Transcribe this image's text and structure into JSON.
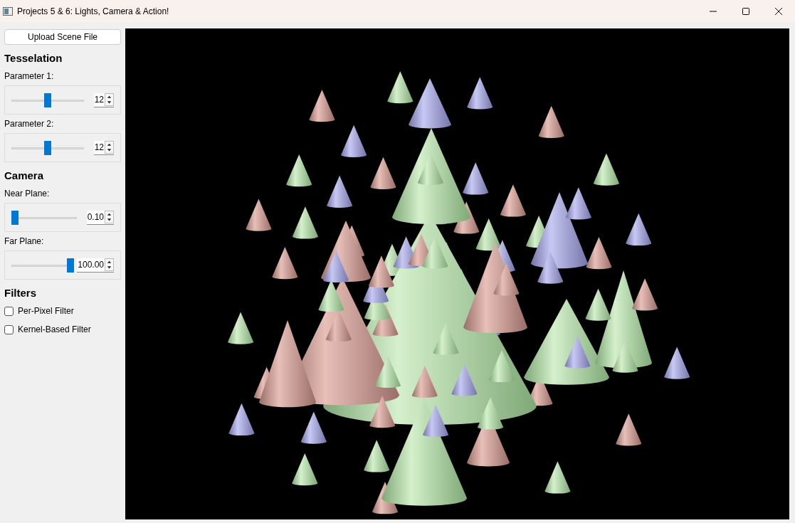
{
  "window": {
    "title": "Projects 5 & 6: Lights, Camera & Action!"
  },
  "upload_button": {
    "label": "Upload Scene File"
  },
  "sections": [
    {
      "title": "Tesselation",
      "controls": [
        {
          "kind": "slider",
          "label": "Parameter 1:",
          "level": 0.45,
          "value": "12"
        },
        {
          "kind": "slider",
          "label": "Parameter 2:",
          "level": 0.45,
          "value": "12"
        }
      ]
    },
    {
      "title": "Camera",
      "controls": [
        {
          "kind": "slider",
          "label": "Near Plane:",
          "level": 0.0,
          "value": "0.10"
        },
        {
          "kind": "slider",
          "label": "Far Plane:",
          "level": 1.0,
          "value": "100.00"
        }
      ]
    },
    {
      "title": "Filters",
      "controls": [
        {
          "kind": "checkbox",
          "label": "Per-Pixel Filter",
          "checked": false
        },
        {
          "kind": "checkbox",
          "label": "Kernel-Based Filter",
          "checked": false
        }
      ]
    }
  ]
}
